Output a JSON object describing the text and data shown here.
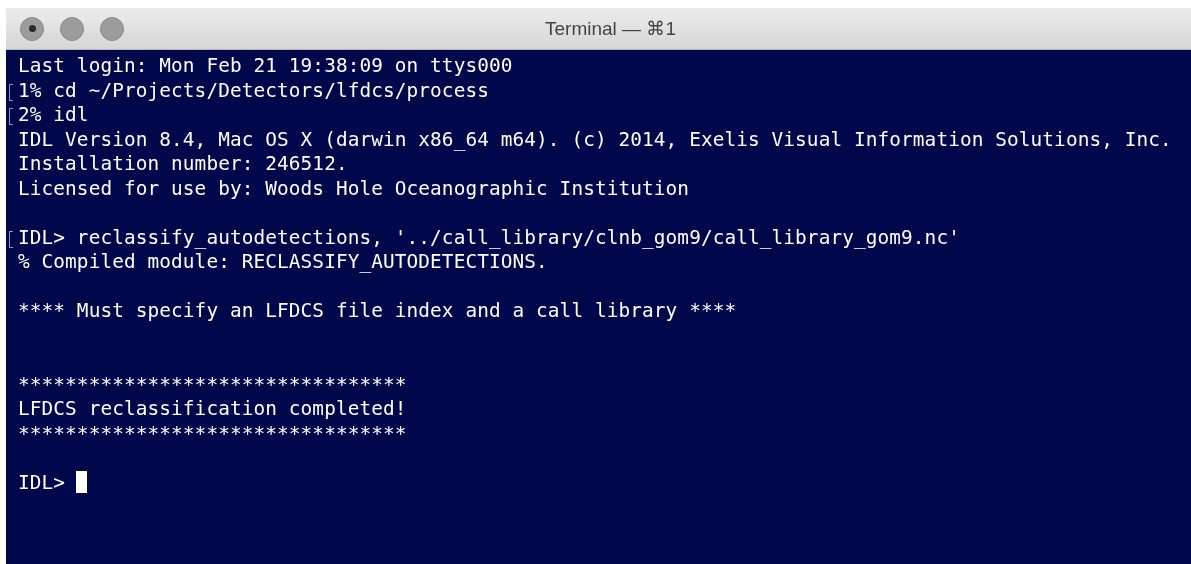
{
  "window": {
    "title": "Terminal — ⌘1",
    "controls": [
      {
        "dot": true
      },
      {
        "dot": false
      },
      {
        "dot": false
      }
    ]
  },
  "terminal": {
    "lines": [
      {
        "kind": "text",
        "text": "Last login: Mon Feb 21 19:38:09 on ttys000",
        "marked": false
      },
      {
        "kind": "text",
        "text": "1% cd ~/Projects/Detectors/lfdcs/process",
        "marked": true
      },
      {
        "kind": "text",
        "text": "2% idl",
        "marked": true
      },
      {
        "kind": "text",
        "text": "IDL Version 8.4, Mac OS X (darwin x86_64 m64). (c) 2014, Exelis Visual Information Solutions, Inc.",
        "marked": false
      },
      {
        "kind": "text",
        "text": "Installation number: 246512.",
        "marked": false
      },
      {
        "kind": "text",
        "text": "Licensed for use by: Woods Hole Oceanographic Institution",
        "marked": false
      },
      {
        "kind": "blank"
      },
      {
        "kind": "text",
        "text": "IDL> reclassify_autodetections, '../call_library/clnb_gom9/call_library_gom9.nc'",
        "marked": true
      },
      {
        "kind": "text",
        "text": "% Compiled module: RECLASSIFY_AUTODETECTIONS.",
        "marked": false
      },
      {
        "kind": "blank"
      },
      {
        "kind": "text",
        "text": "**** Must specify an LFDCS file index and a call library ****",
        "marked": false
      },
      {
        "kind": "blank"
      },
      {
        "kind": "blank"
      },
      {
        "kind": "text",
        "text": "*********************************",
        "marked": false
      },
      {
        "kind": "text",
        "text": "LFDCS reclassification completed!",
        "marked": false
      },
      {
        "kind": "text",
        "text": "*********************************",
        "marked": false
      },
      {
        "kind": "blank"
      },
      {
        "kind": "prompt",
        "text": "IDL>"
      }
    ]
  }
}
